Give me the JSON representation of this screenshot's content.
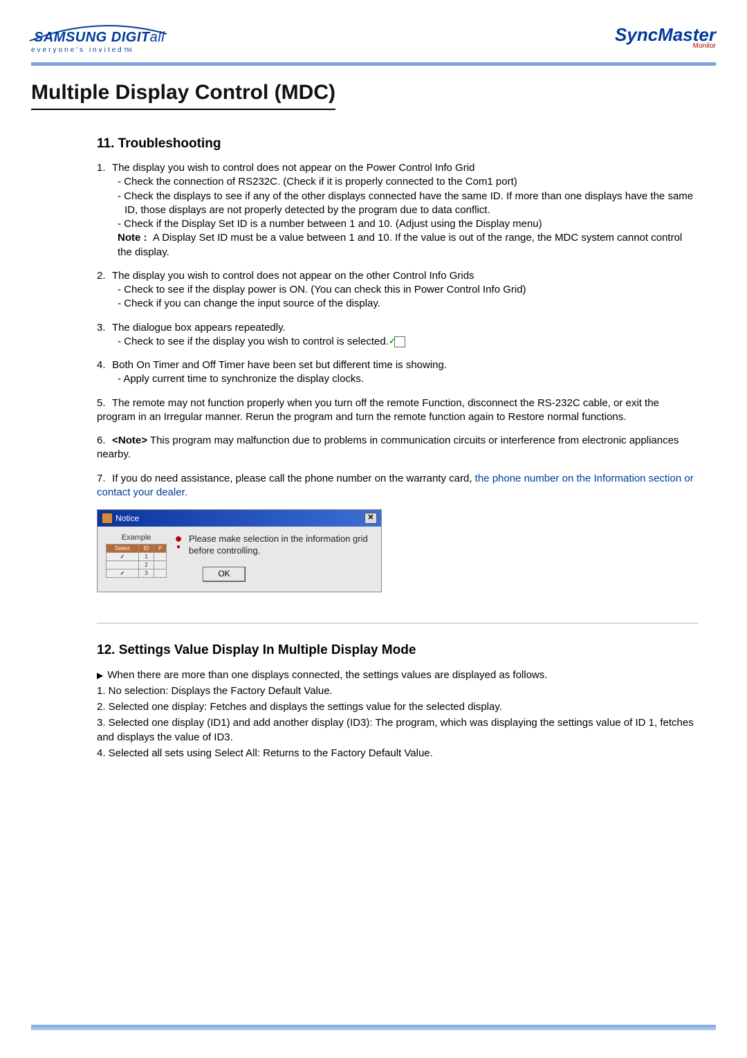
{
  "header": {
    "brand_main": "SAMSUNG DIGIT",
    "brand_suffix": "all",
    "tagline": "everyone's invited",
    "tagline_tm": "TM",
    "product": "SyncMaster",
    "product_sub": "Monitor"
  },
  "main_title": "Multiple Display Control (MDC)",
  "sec11": {
    "heading": "11. Troubleshooting",
    "i1": {
      "num": "1.",
      "text": "The display you wish to control does not appear on the Power Control Info Grid",
      "s1": "- Check the connection of RS232C. (Check if it is properly connected to the Com1 port)",
      "s2": "- Check the displays to see if any of the other displays connected have the same ID. If more than one displays have the same ID, those displays are not properly detected by the program due to data conflict.",
      "s3": "- Check if the Display Set ID is a number between 1 and 10. (Adjust using the Display menu)",
      "note_label": "Note :",
      "note_text": "A Display Set ID must be a value between 1 and 10. If the value is out of the range, the MDC system cannot control the display."
    },
    "i2": {
      "num": "2.",
      "text": "The display you wish to control does not appear on the other Control Info Grids",
      "s1": "- Check to see if the display power is ON. (You can check this in Power Control Info Grid)",
      "s2": "- Check if you can change the input source of the display."
    },
    "i3": {
      "num": "3.",
      "text": "The dialogue box appears repeatedly.",
      "s1": "- Check to see if the display you wish to control is selected."
    },
    "i4": {
      "num": "4.",
      "text": "Both On Timer and Off Timer have been set but different time is showing.",
      "s1": "- Apply current time to synchronize the display clocks."
    },
    "i5": {
      "num": "5.",
      "text": "The remote may not function properly when you turn off the remote Function, disconnect the RS-232C cable, or exit the program in an Irregular manner. Rerun the program and turn the remote function again to Restore normal functions."
    },
    "i6": {
      "num": "6.",
      "note_label": "<Note>",
      "text": " This program may malfunction due to problems in communication circuits or interference from electronic appliances nearby."
    },
    "i7": {
      "num": "7.",
      "text_a": "If you do need assistance, please call the phone number on the warranty card, ",
      "text_link": "the phone number on the Information section or contact your dealer."
    }
  },
  "dialog": {
    "title": "Notice",
    "example_label": "Example",
    "th_select": "Select",
    "th_id": "ID",
    "th_p": "P",
    "r1_id": "1",
    "r2_id": "2",
    "r3_id": "3",
    "warn": "!",
    "msg": "Please make selection in the information grid before controlling.",
    "ok": "OK",
    "close": "✕"
  },
  "sec12": {
    "heading": "12. Settings Value Display In Multiple Display Mode",
    "intro": "When there are more than one displays connected, the settings values are displayed as follows.",
    "r1": "1. No selection: Displays the Factory Default Value.",
    "r2": "2. Selected one display: Fetches and displays the settings value for the selected display.",
    "r3": "3. Selected one display (ID1) and add another display (ID3): The program, which was displaying the settings value of ID 1, fetches and displays the value of ID3.",
    "r4": "4. Selected all sets using Select All: Returns to the Factory Default Value."
  }
}
